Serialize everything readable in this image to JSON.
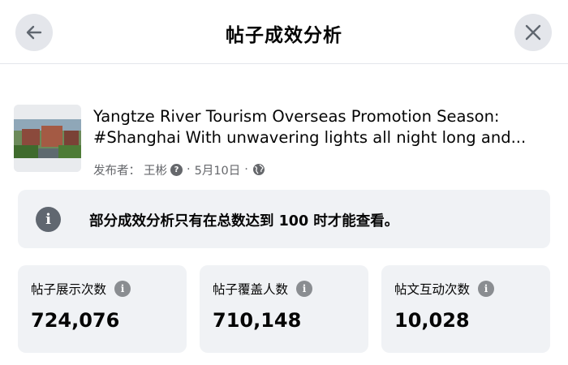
{
  "header": {
    "title": "帖子成效分析",
    "back_icon": "arrow-left-icon",
    "close_icon": "close-icon"
  },
  "post": {
    "thumbnail_icon": "post-thumbnail-image",
    "title_line1": "Yangtze River Tourism Overseas Promotion Season:",
    "title_line2": "#Shanghai With unwavering lights all night long and...",
    "publisher_label": "发布者：",
    "publisher_name": "王彬",
    "separator": "·",
    "date": "5月10日",
    "audience_icon": "globe-icon"
  },
  "notice": {
    "icon": "info-icon",
    "text": "部分成效分析只有在总数达到 100 时才能查看。"
  },
  "stats": [
    {
      "label": "帖子展示次数",
      "value": "724,076"
    },
    {
      "label": "帖子覆盖人数",
      "value": "710,148"
    },
    {
      "label": "帖文互动次数",
      "value": "10,028"
    }
  ],
  "colors": {
    "card_bg": "#f0f2f5",
    "button_bg": "#e4e6eb",
    "secondary_text": "#65676b"
  }
}
